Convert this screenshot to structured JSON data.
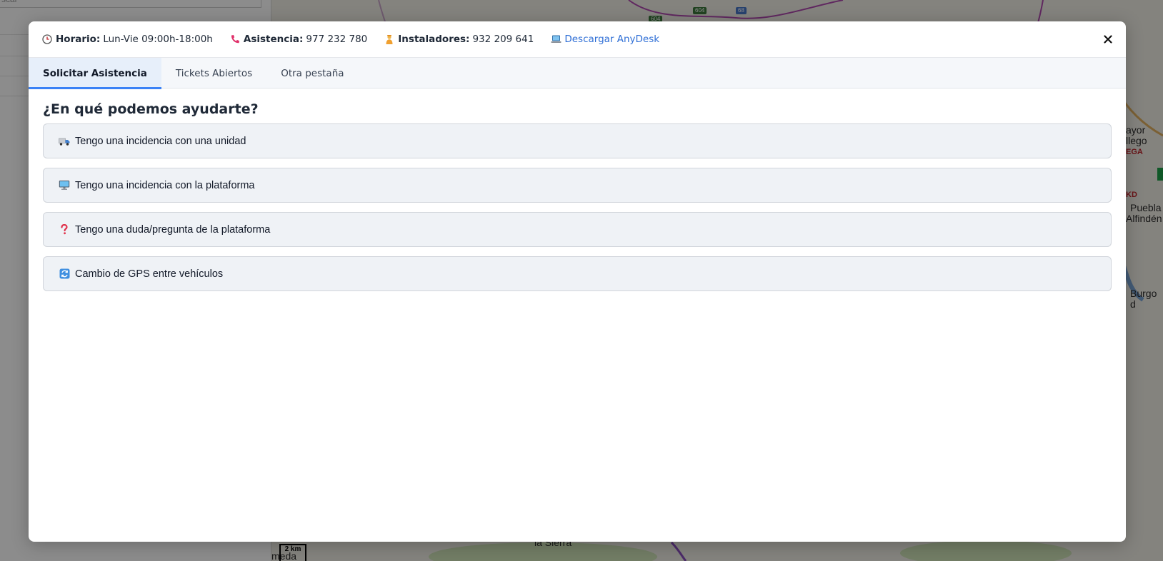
{
  "background": {
    "search_placeholder": "scar",
    "map_labels": {
      "mayor": "ayor",
      "gallego": "llego",
      "nega": "EGA",
      "kd": "KD",
      "puebla": "Puebla",
      "alfinden": "Alfindén",
      "burgo": "Burgo d",
      "sierra": "la Sierra",
      "meda": "meda"
    },
    "road_shields": [
      "604",
      "68"
    ],
    "scale_label": "2 km"
  },
  "header": {
    "schedule": {
      "icon": "clock-icon",
      "label": "Horario:",
      "value": "Lun-Vie 09:00h-18:00h"
    },
    "support": {
      "icon": "phone-icon",
      "label": "Asistencia:",
      "value": "977 232 780"
    },
    "installers": {
      "icon": "installer-icon",
      "label": "Instaladores:",
      "value": "932 209 641"
    },
    "anydesk": {
      "icon": "laptop-icon",
      "label": "Descargar AnyDesk"
    },
    "close": "✕"
  },
  "tabs": [
    {
      "label": "Solicitar Asistencia",
      "active": true
    },
    {
      "label": "Tickets Abiertos",
      "active": false
    },
    {
      "label": "Otra pestaña",
      "active": false
    }
  ],
  "content": {
    "heading": "¿En qué podemos ayudarte?",
    "options": [
      {
        "icon": "truck-icon",
        "label": "Tengo una incidencia con una unidad"
      },
      {
        "icon": "monitor-icon",
        "label": "Tengo una incidencia con la plataforma"
      },
      {
        "icon": "question-icon",
        "label": "Tengo una duda/pregunta de la plataforma"
      },
      {
        "icon": "swap-icon",
        "label": "Cambio de GPS entre vehículos"
      }
    ]
  },
  "colors": {
    "accent": "#3b82f6",
    "link": "#2f6fd6",
    "option_bg": "#eff2f6",
    "active_tab_bg": "#e7effa"
  }
}
